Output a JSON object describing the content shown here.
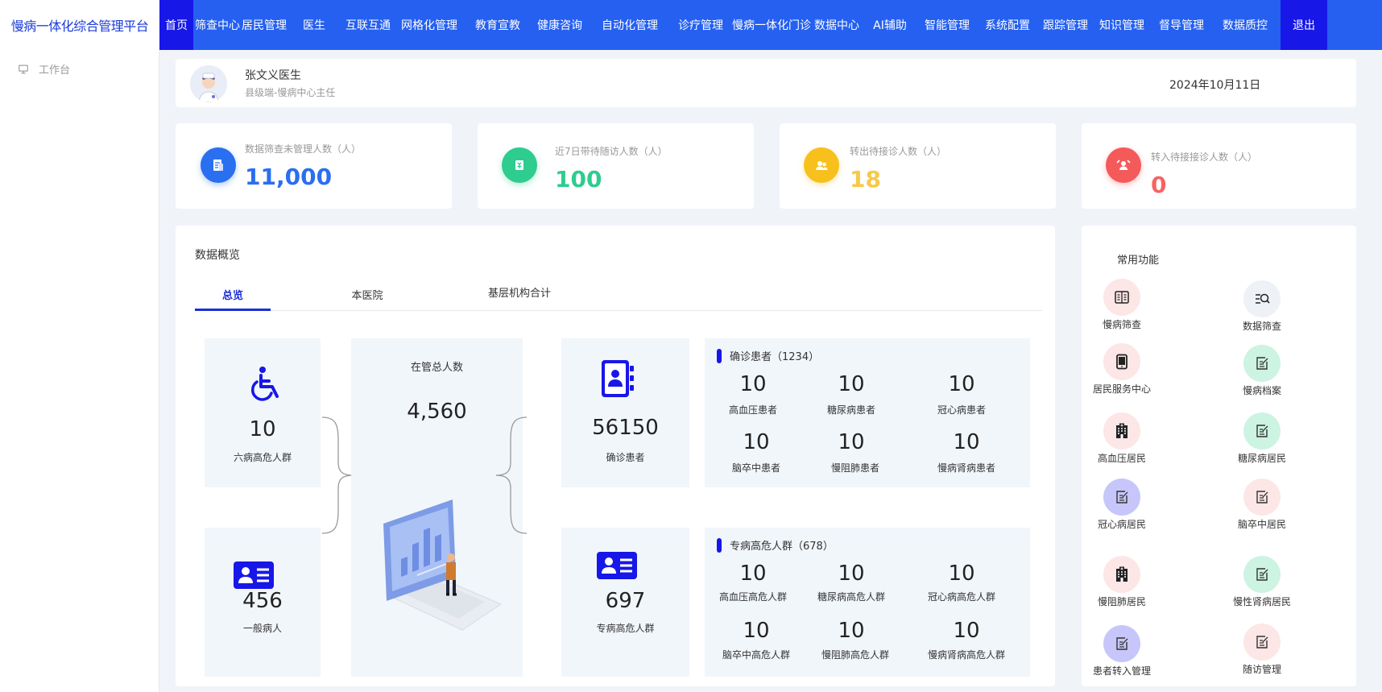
{
  "brand": "慢病一体化综合管理平台",
  "sidebar": {
    "items": [
      {
        "label": "工作台",
        "icon": "monitor-icon"
      }
    ]
  },
  "nav": {
    "items": [
      "首页",
      "筛查中心",
      "居民管理",
      "医生",
      "互联互通",
      "网格化管理",
      "教育宣教",
      "健康咨询",
      "自动化管理",
      "诊疗管理",
      "慢病一体化门诊",
      "数据中心",
      "AI辅助",
      "智能管理",
      "系统配置",
      "跟踪管理",
      "知识管理",
      "督导管理",
      "数据质控",
      "退出"
    ],
    "active": "首页"
  },
  "user": {
    "name": "张文义医生",
    "role": "县级端-慢病中心主任",
    "date": "2024年10月11日"
  },
  "stats": [
    {
      "label": "数据筛查未管理人数（人）",
      "value": "11,000",
      "color": "#2a6ff0",
      "icon": "document-icon"
    },
    {
      "label": "近7日带待随访人数（人）",
      "value": "100",
      "color": "#2ecc8f",
      "icon": "calendar-icon"
    },
    {
      "label": "转出待接诊人数（人）",
      "value": "18",
      "color": "#f7c948",
      "icon": "users-icon"
    },
    {
      "label": "转入待接接诊人数（人）",
      "value": "0",
      "color": "#f56464",
      "icon": "transfer-icon"
    }
  ],
  "overview": {
    "title": "数据概览",
    "tabs": [
      "总览",
      "本医院",
      "基层机构合计"
    ],
    "high_risk": {
      "value": "10",
      "label": "六病高危人群"
    },
    "general": {
      "value": "456",
      "label": "一般病人"
    },
    "total": {
      "label": "在管总人数",
      "value": "4,560"
    },
    "confirmed": {
      "value": "56150",
      "label": "确诊患者"
    },
    "special_risk": {
      "value": "697",
      "label": "专病高危人群"
    },
    "confirmed_section": {
      "title": "确诊患者（1234）",
      "items": [
        {
          "value": "10",
          "label": "高血压患者"
        },
        {
          "value": "10",
          "label": "糖尿病患者"
        },
        {
          "value": "10",
          "label": "冠心病患者"
        },
        {
          "value": "10",
          "label": "脑卒中患者"
        },
        {
          "value": "10",
          "label": "慢阻肺患者"
        },
        {
          "value": "10",
          "label": "慢病肾病患者"
        }
      ]
    },
    "risk_section": {
      "title": "专病高危人群（678）",
      "items": [
        {
          "value": "10",
          "label": "高血压高危人群"
        },
        {
          "value": "10",
          "label": "糖尿病高危人群"
        },
        {
          "value": "10",
          "label": "冠心病高危人群"
        },
        {
          "value": "10",
          "label": "脑卒中高危人群"
        },
        {
          "value": "10",
          "label": "慢阻肺高危人群"
        },
        {
          "value": "10",
          "label": "慢病肾病高危人群"
        }
      ]
    }
  },
  "quick": {
    "title": "常用功能",
    "items": [
      {
        "label": "慢病筛查",
        "icon": "book-icon",
        "bg": "#fde6e6"
      },
      {
        "label": "数据筛查",
        "icon": "search-list-icon",
        "bg": "#eef1f6"
      },
      {
        "label": "居民服务中心",
        "icon": "tablet-icon",
        "bg": "#fde6e6"
      },
      {
        "label": "慢病档案",
        "icon": "edit-icon",
        "bg": "#cdf3e2"
      },
      {
        "label": "高血压居民",
        "icon": "hospital-icon",
        "bg": "#fde6e6"
      },
      {
        "label": "糖尿病居民",
        "icon": "edit-icon",
        "bg": "#cdf3e2"
      },
      {
        "label": "冠心病居民",
        "icon": "edit-icon",
        "bg": "#c6c6fb"
      },
      {
        "label": "脑卒中居民",
        "icon": "edit-icon",
        "bg": "#fde6e6"
      },
      {
        "label": "慢阻肺居民",
        "icon": "hospital-icon",
        "bg": "#fde6e6"
      },
      {
        "label": "慢性肾病居民",
        "icon": "edit-icon",
        "bg": "#cdf3e2"
      },
      {
        "label": "患者转入管理",
        "icon": "edit-icon",
        "bg": "#c6c6fb"
      },
      {
        "label": "随访管理",
        "icon": "edit-icon",
        "bg": "#fde6e6"
      }
    ]
  }
}
